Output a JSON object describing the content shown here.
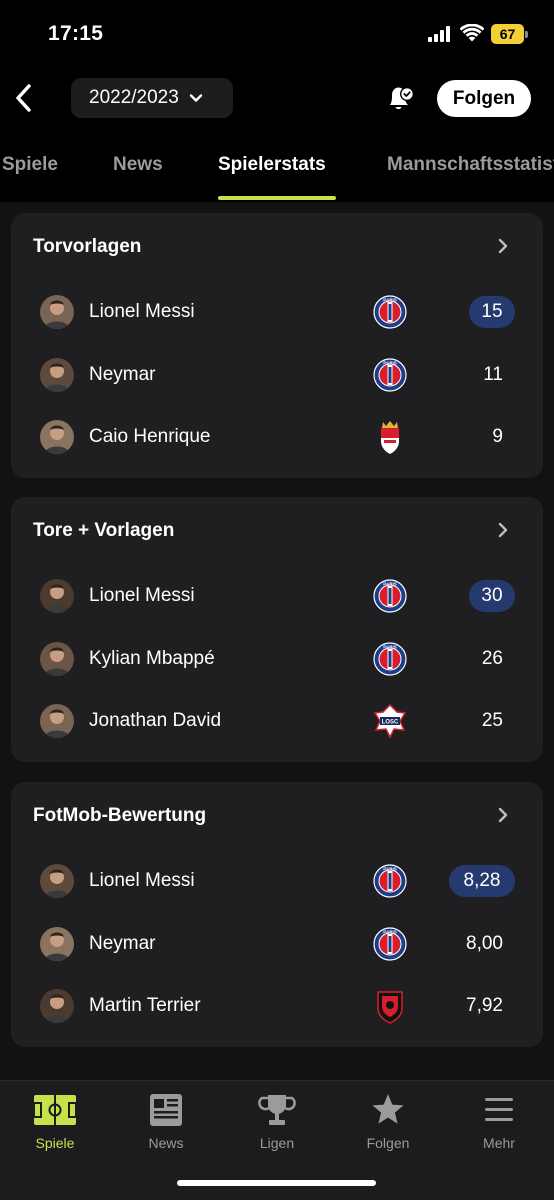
{
  "status_bar": {
    "time": "17:15",
    "battery": "67"
  },
  "header": {
    "season": "2022/2023",
    "follow_label": "Folgen"
  },
  "tabs": [
    {
      "label": "Spiele"
    },
    {
      "label": "News"
    },
    {
      "label": "Spielerstats",
      "active": true
    },
    {
      "label": "Mannschaftsstatistiken"
    }
  ],
  "cards": [
    {
      "title": "Torvorlagen",
      "rows": [
        {
          "name": "Lionel Messi",
          "club": "psg",
          "value": "15",
          "highlight": true
        },
        {
          "name": "Neymar",
          "club": "psg",
          "value": "11"
        },
        {
          "name": "Caio Henrique",
          "club": "monaco",
          "value": "9"
        }
      ]
    },
    {
      "title": "Tore + Vorlagen",
      "rows": [
        {
          "name": "Lionel Messi",
          "club": "psg",
          "value": "30",
          "highlight": true
        },
        {
          "name": "Kylian Mbappé",
          "club": "psg",
          "value": "26"
        },
        {
          "name": "Jonathan David",
          "club": "lille",
          "value": "25"
        }
      ]
    },
    {
      "title": "FotMob-Bewertung",
      "rows": [
        {
          "name": "Lionel Messi",
          "club": "psg",
          "value": "8,28",
          "highlight": true
        },
        {
          "name": "Neymar",
          "club": "psg",
          "value": "8,00"
        },
        {
          "name": "Martin Terrier",
          "club": "rennes",
          "value": "7,92"
        }
      ]
    }
  ],
  "bottom_nav": [
    {
      "label": "Spiele",
      "icon": "pitch-icon",
      "active": true
    },
    {
      "label": "News",
      "icon": "newspaper-icon"
    },
    {
      "label": "Ligen",
      "icon": "trophy-icon"
    },
    {
      "label": "Folgen",
      "icon": "star-icon"
    },
    {
      "label": "Mehr",
      "icon": "menu-icon"
    }
  ],
  "colors": {
    "accent": "#c6e24a",
    "highlight_pill": "#253a6f",
    "card": "#1f1f21"
  }
}
